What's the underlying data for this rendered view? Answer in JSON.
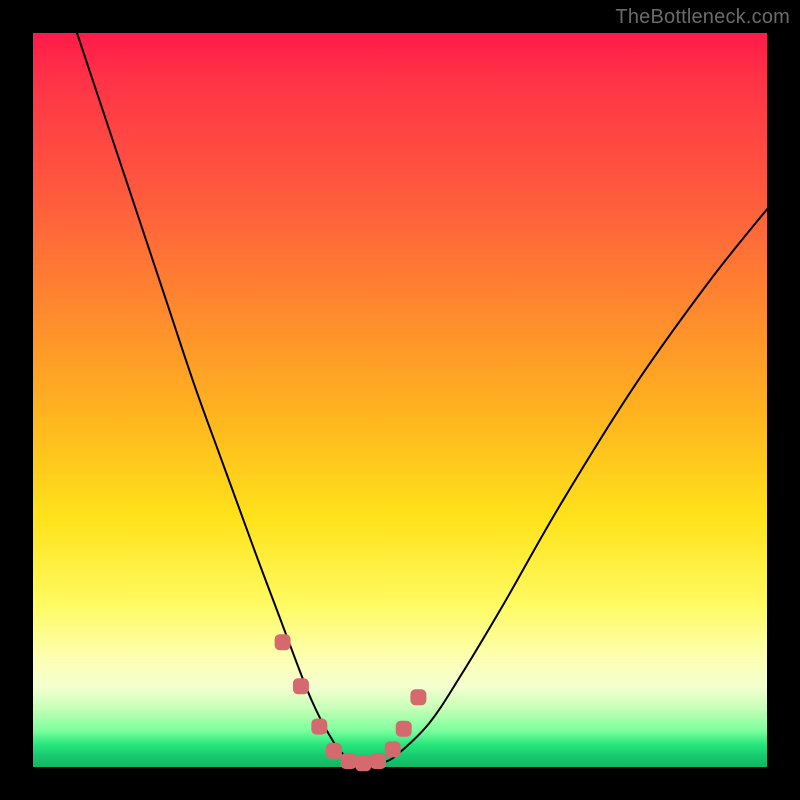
{
  "watermark": "TheBottleneck.com",
  "chart_data": {
    "type": "line",
    "title": "",
    "xlabel": "",
    "ylabel": "",
    "xlim": [
      0,
      100
    ],
    "ylim": [
      0,
      100
    ],
    "grid": false,
    "background_gradient": {
      "top_color": "#ff1a49",
      "mid_color": "#ffe21a",
      "bottom_color": "#18c96f"
    },
    "series": [
      {
        "name": "bottleneck-curve",
        "stroke": "#000000",
        "x": [
          6,
          10,
          14,
          18,
          22,
          26,
          30,
          33,
          36,
          38,
          40,
          42,
          44,
          46,
          48,
          50,
          54,
          58,
          64,
          72,
          82,
          92,
          100
        ],
        "values": [
          100,
          88,
          76,
          64,
          52,
          41,
          30,
          22,
          14,
          9,
          5,
          2,
          0.7,
          0.4,
          0.7,
          2,
          6,
          12,
          22,
          36,
          52,
          66,
          76
        ]
      }
    ],
    "markers": {
      "name": "bottleneck-markers",
      "fill": "#d46a6e",
      "shape": "rounded-square",
      "x": [
        34,
        36.5,
        39,
        41,
        43,
        45,
        47,
        49,
        50.5,
        52.5
      ],
      "values": [
        17,
        11,
        5.5,
        2.2,
        0.8,
        0.5,
        0.8,
        2.4,
        5.2,
        9.5
      ]
    }
  }
}
